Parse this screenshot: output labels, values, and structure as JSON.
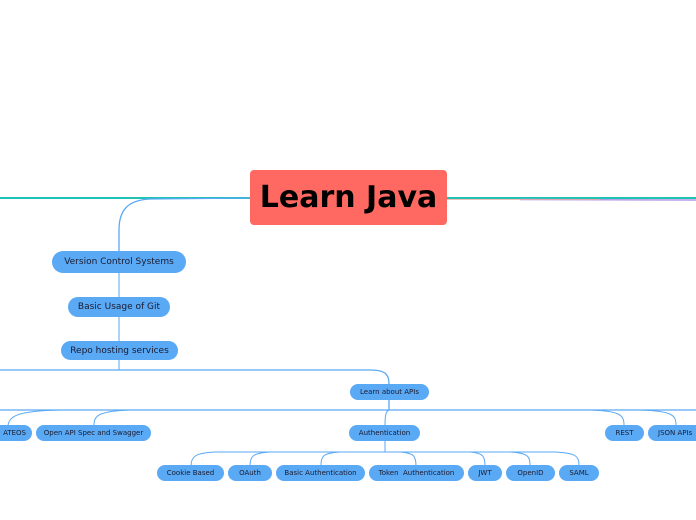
{
  "mindmap": {
    "root": {
      "label": "Learn Java",
      "color": "#ff6961"
    },
    "branch_color": "#5aa9f5",
    "nodes": {
      "version_control": "Version Control Systems",
      "basic_git": "Basic Usage of Git",
      "repo_hosting": "Repo hosting services",
      "learn_apis": "Learn about APIs",
      "hateoas": "HATEOAS",
      "open_api": "Open API Spec and Swagger",
      "authentication": "Authentication",
      "rest": "REST",
      "json_apis": "JSON APIs",
      "cookie_based": "Cookie Based",
      "oauth": "OAuth",
      "basic_auth": "Basic Authentication",
      "token_auth": "Token  Authentication",
      "jwt": "JWT",
      "openid": "OpenID",
      "saml": "SAML"
    },
    "visible_hateoas_text": "ATEOS"
  }
}
